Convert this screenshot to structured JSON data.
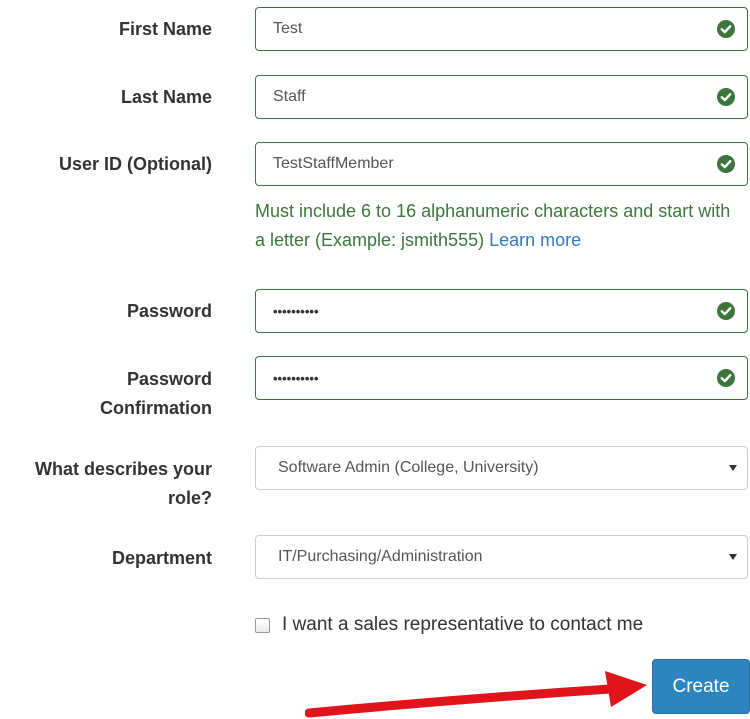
{
  "form": {
    "first_name": {
      "label": "First Name",
      "value": "Test"
    },
    "last_name": {
      "label": "Last Name",
      "value": "Staff"
    },
    "user_id": {
      "label": "User ID (Optional)",
      "value": "TestStaffMember"
    },
    "user_id_help": {
      "text": "Must include 6 to 16 alphanumeric characters and start with a letter (Example: jsmith555)",
      "link": "Learn more"
    },
    "password": {
      "label": "Password",
      "value": "••••••••••"
    },
    "password_confirmation": {
      "label_line1": "Password",
      "label_line2": "Confirmation",
      "value": "••••••••••"
    },
    "role": {
      "label_line1": "What describes your",
      "label_line2": "role?",
      "selected": "Software Admin (College, University)"
    },
    "department": {
      "label": "Department",
      "selected": "IT/Purchasing/Administration"
    },
    "sales_contact": {
      "label": "I want a sales representative to contact me",
      "checked": false
    },
    "create_label": "Create"
  },
  "colors": {
    "valid_border": "#3c763d",
    "valid_text": "#3c763d",
    "link": "#337ab7",
    "button": "#2e84be",
    "arrow": "#e0141a"
  },
  "icons": {
    "valid": "check-circle-icon",
    "select": "caret-down-icon",
    "annotation": "red-arrow-icon"
  }
}
